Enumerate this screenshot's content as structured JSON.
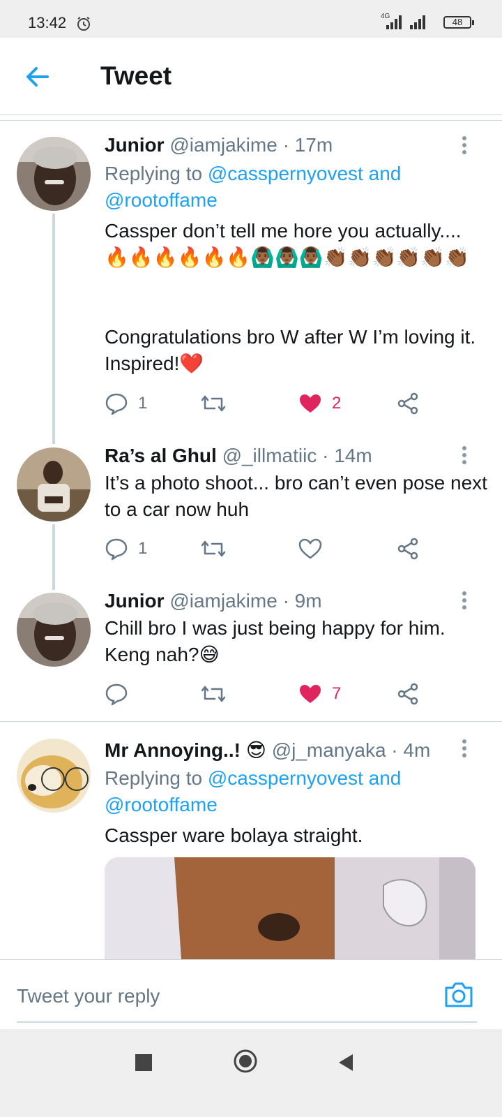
{
  "status_bar": {
    "time": "13:42",
    "network": "4G",
    "battery": "48"
  },
  "header": {
    "title": "Tweet"
  },
  "tweets": [
    {
      "name": "Junior",
      "meta": "@iamjakime · 17m",
      "replying_prefix": "Replying to ",
      "replying_handles": "@casspernyovest and @rootoffame",
      "body": "Cassper don’t tell me hore you actually.... 🔥🔥🔥🔥🔥🔥🙆🏾‍♂️🙆🏾‍♂️🙆🏾‍♂️👏🏾👏🏾👏🏾👏🏾👏🏾👏🏾",
      "body2": "Congratulations bro W after W I’m loving it. Inspired!❤️",
      "replies": "1",
      "likes": "2",
      "liked": true
    },
    {
      "name": "Ra’s al Ghul",
      "meta": "@_illmatiic · 14m",
      "body": "It’s a photo shoot... bro can’t even pose next to a car now huh",
      "replies": "1",
      "likes": "",
      "liked": false
    },
    {
      "name": "Junior",
      "meta": "@iamjakime · 9m",
      "body": "Chill bro I was just being happy for him. Keng nah?😅",
      "replies": "",
      "likes": "7",
      "liked": true
    },
    {
      "name": "Mr Annoying..! 😎",
      "meta": "@j_manyaka · 4m",
      "replying_prefix": "Replying to ",
      "replying_handles": "@casspernyovest and @rootoffame",
      "body": "Cassper ware bolaya straight."
    }
  ],
  "reply_bar": {
    "placeholder": "Tweet your reply"
  },
  "icons": {
    "back": "arrow-left-icon",
    "reply": "speech-bubble-icon",
    "retweet": "retweet-icon",
    "like": "heart-icon",
    "share": "share-icon",
    "more": "more-vertical-icon",
    "camera": "camera-icon"
  },
  "colors": {
    "accent": "#1da1f2",
    "like": "#e0245e",
    "muted": "#657786"
  }
}
